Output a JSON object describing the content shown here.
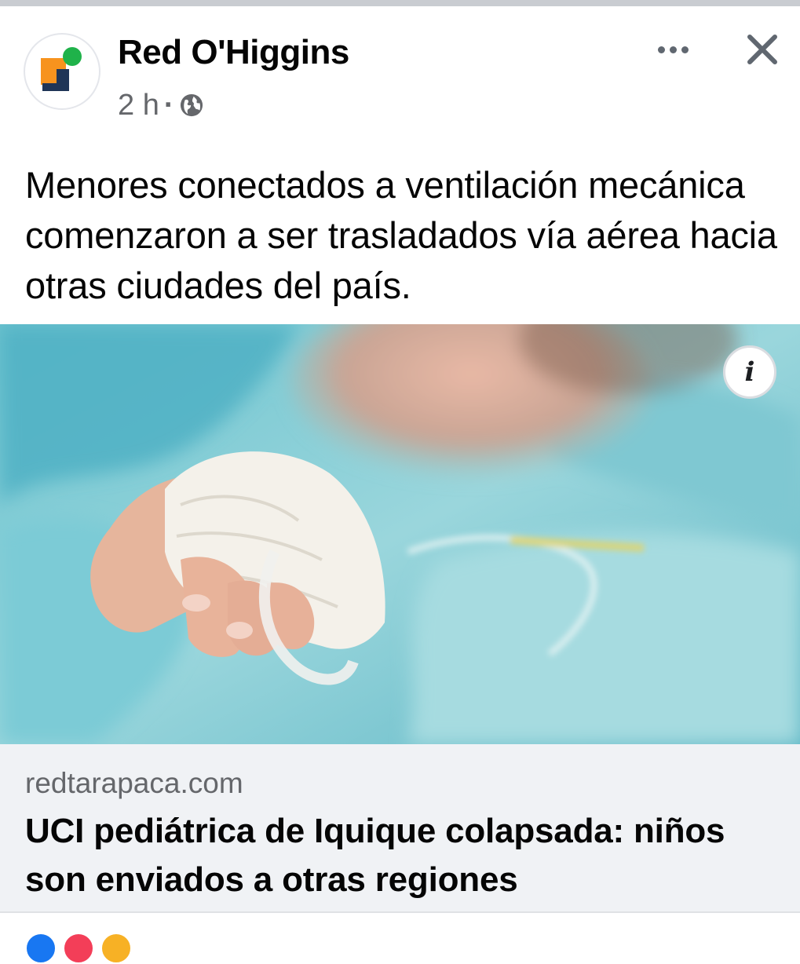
{
  "header": {
    "page_name": "Red O'Higgins",
    "time": "2 h",
    "separator": "·",
    "audience_icon": "globe-icon",
    "more_icon": "more-dots-icon",
    "close_icon": "close-icon",
    "avatar_icon": "red-ohiggins-logo",
    "colors": {
      "logo_orange": "#f7931e",
      "logo_navy": "#1f3557",
      "logo_green": "#1fb24a"
    }
  },
  "post": {
    "text": "Menores conectados a ventilación mecánica comenzaron a ser trasladados vía aérea hacia otras ciudades del país."
  },
  "link_preview": {
    "info_icon": "info-icon",
    "info_label": "i",
    "domain": "redtarapaca.com",
    "title": "UCI pediátrica de Iquique colapsada: niños son enviados a otras regiones"
  },
  "reactions": [
    "like-reaction-icon",
    "love-reaction-icon",
    "care-reaction-icon"
  ]
}
